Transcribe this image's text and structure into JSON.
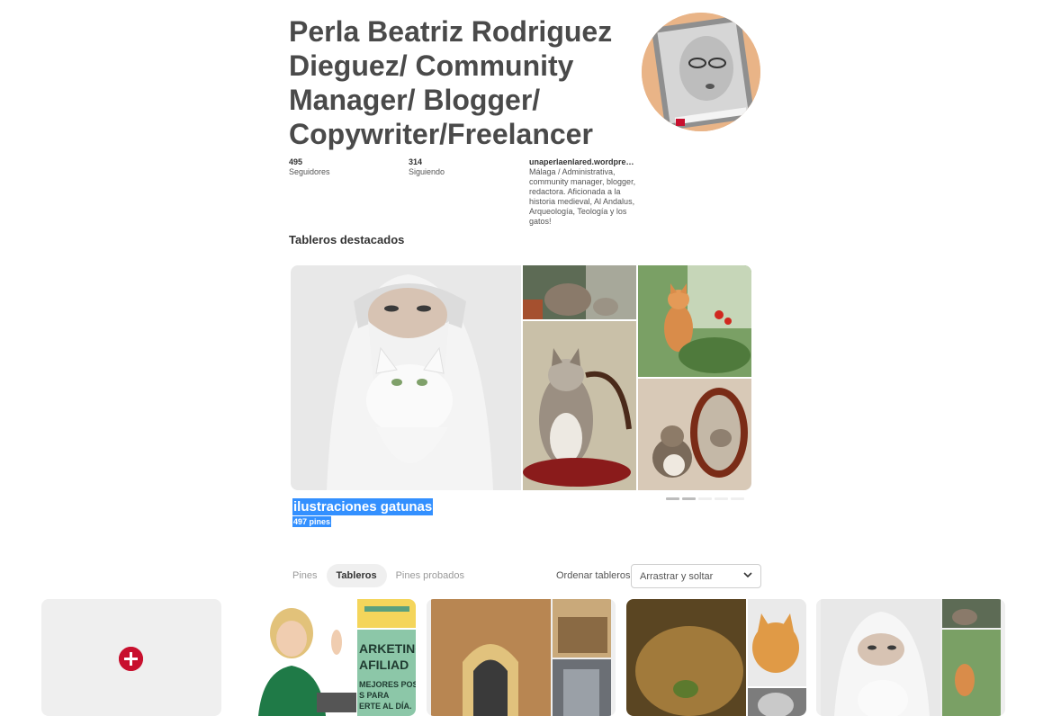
{
  "profile": {
    "name": "Perla Beatriz Rodriguez Dieguez/ Community Manager/ Blogger/ Copywriter/Freelancer",
    "followers_count": "495",
    "followers_label": "Seguidores",
    "following_count": "314",
    "following_label": "Siguiendo",
    "website": "unaperlaenlared.wordpres...",
    "bio": "Málaga / Administrativa, community manager, blogger, redactora. Aficionada a la historia medieval, Al Andalus, Arqueología, Teología y los gatos!"
  },
  "featured": {
    "heading": "Tableros destacados",
    "board_title": "ilustraciones gatunas",
    "pin_count": "497 pines",
    "pager_total": 6,
    "pager_active": 2
  },
  "tabs": [
    {
      "label": "Pines",
      "active": false
    },
    {
      "label": "Tableros",
      "active": true
    },
    {
      "label": "Pines probados",
      "active": false
    }
  ],
  "sort": {
    "label": "Ordenar tableros",
    "selected": "Arrastrar y soltar"
  },
  "boards_row": {
    "add_icon": "plus-icon",
    "cards": [
      {
        "name": "board-card-1"
      },
      {
        "name": "board-card-2"
      },
      {
        "name": "board-card-3"
      },
      {
        "name": "board-card-4"
      }
    ],
    "card3_text": "MARKETING AFILIADO MEJORES POSTS PARA ESTAR AL DIA"
  },
  "colors": {
    "accent_red": "#c8102e",
    "selection_blue": "#3390ff",
    "tab_active_bg": "#efefef"
  }
}
